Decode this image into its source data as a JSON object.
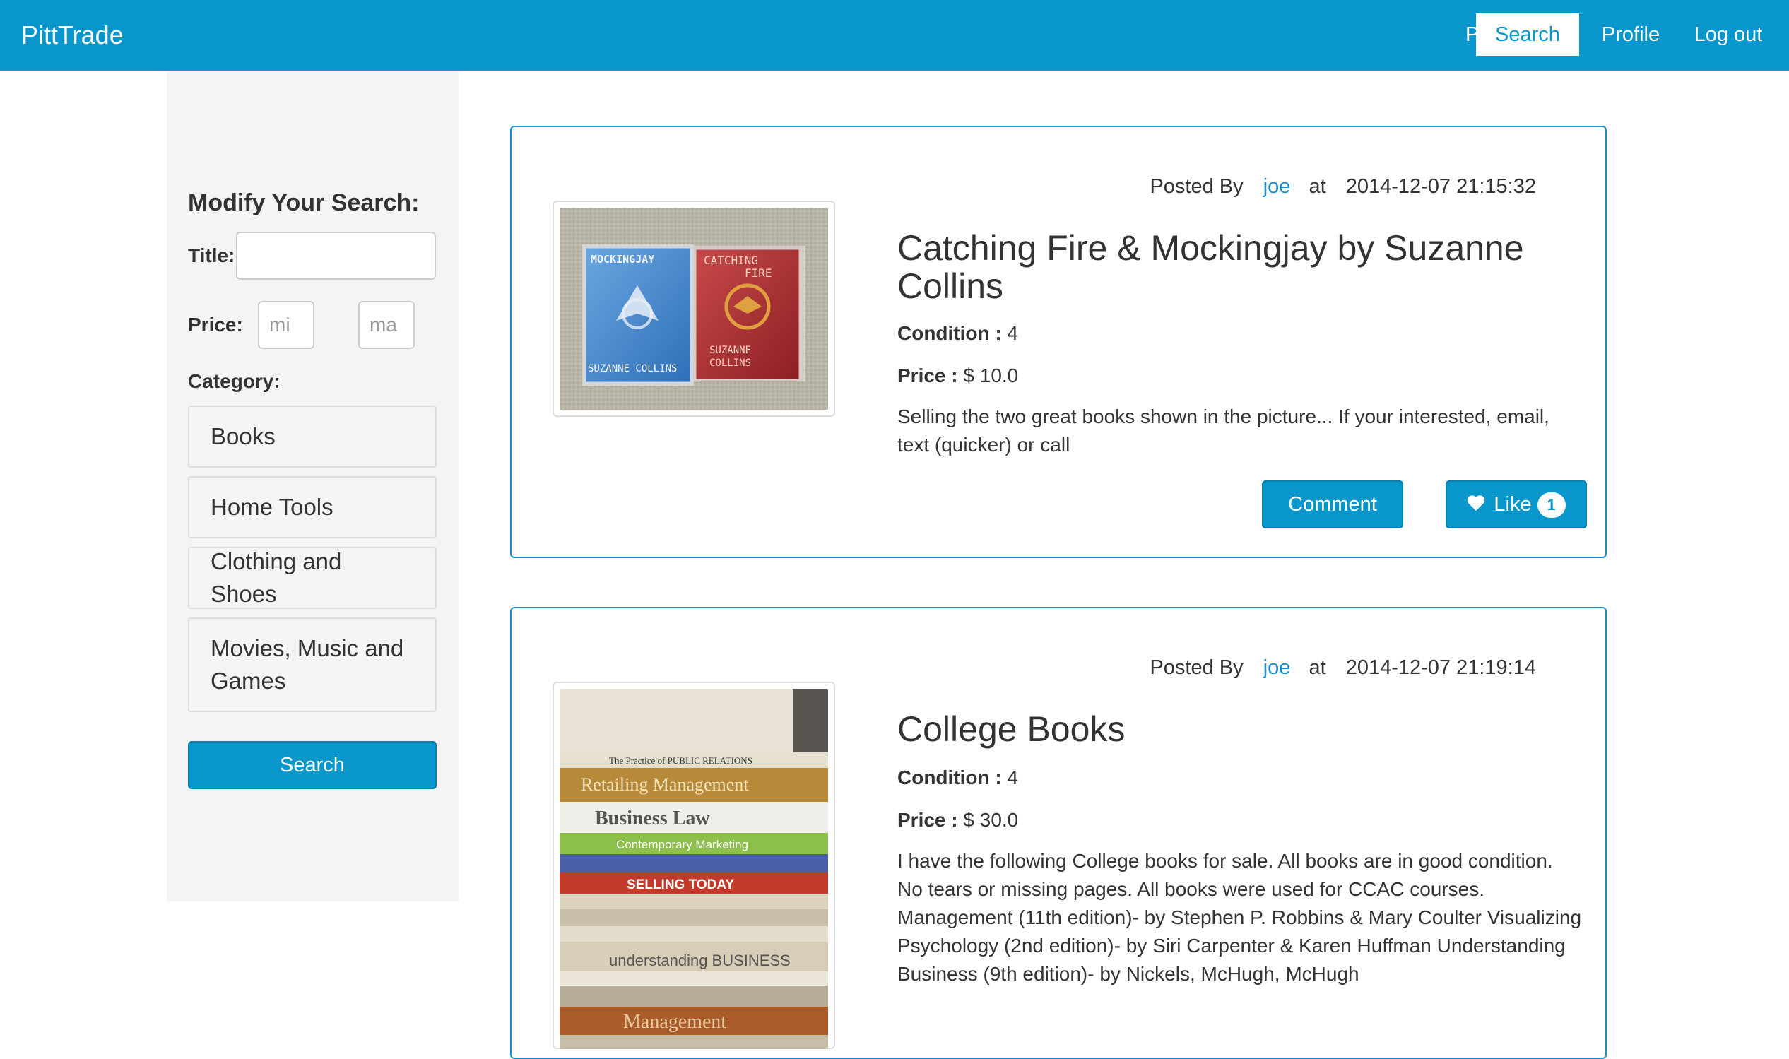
{
  "navbar": {
    "brand": "PittTrade",
    "links": [
      {
        "label": "Post"
      },
      {
        "label": "Search"
      },
      {
        "label": "Profile"
      },
      {
        "label": "Log out"
      }
    ]
  },
  "sidebar": {
    "heading": "Modify Your Search:",
    "title_label": "Title:",
    "title_value": "",
    "price_label": "Price:",
    "price_min_placeholder": "mi",
    "price_max_placeholder": "ma",
    "category_label": "Category:",
    "categories": [
      "Books",
      "Home Tools",
      "Clothing and Shoes",
      "Movies, Music and Games"
    ],
    "search_button": "Search"
  },
  "posts": [
    {
      "posted_by_label": "Posted By",
      "user": "joe",
      "at_label": "at",
      "timestamp": "2014-12-07 21:15:32",
      "title": "Catching Fire & Mockingjay by Suzanne Collins",
      "condition_label": "Condition :",
      "condition": "4",
      "price_label": "Price :",
      "price": "$ 10.0",
      "description": "Selling the two great books shown in the picture... If your interested, email, text (quicker) or call",
      "comment_button": "Comment",
      "like_button": "Like",
      "like_count": "1",
      "image_text": {
        "book1_title": "MOCKINGJAY",
        "book1_author": "SUZANNE COLLINS",
        "book2_title1": "CATCHING",
        "book2_title2": "FIRE",
        "book2_author1": "SUZANNE",
        "book2_author2": "COLLINS"
      }
    },
    {
      "posted_by_label": "Posted By",
      "user": "joe",
      "at_label": "at",
      "timestamp": "2014-12-07 21:19:14",
      "title": "College Books",
      "condition_label": "Condition :",
      "condition": "4",
      "price_label": "Price :",
      "price": "$ 30.0",
      "description": "I have the following College books for sale. All books are in good condition. No tears or missing pages. All books were used for CCAC courses. Management (11th edition)- by Stephen P. Robbins & Mary Coulter Visualizing Psychology (2nd edition)- by Siri Carpenter & Karen Huffman Understanding Business (9th edition)- by Nickels, McHugh, McHugh",
      "image_spines": [
        "The Practice of PUBLIC RELATIONS",
        "Retailing Management",
        "Business Law",
        "Contemporary Marketing",
        "SELLING TODAY",
        "understanding BUSINESS",
        "Management"
      ]
    }
  ],
  "colors": {
    "primary": "#0896cb",
    "link": "#1a8fc9",
    "sidebar_bg": "#f4f4f4",
    "text": "#333333"
  }
}
